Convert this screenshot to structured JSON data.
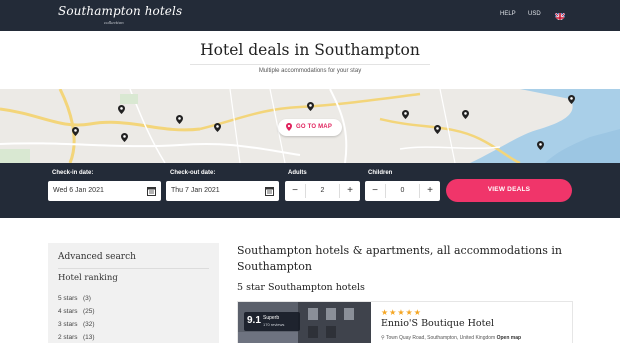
{
  "header": {
    "logo": "Southampton hotels",
    "logo_sub": "collection",
    "help": "HELP",
    "currency": "USD",
    "language_flag": "uk-flag-icon"
  },
  "hero": {
    "title": "Hotel deals in Southampton",
    "subtitle": "Multiple accommodations for your stay"
  },
  "map": {
    "goto_label": "GO TO MAP",
    "water_color": "#a9cfe8",
    "road_color": "#f3d57a"
  },
  "search": {
    "checkin_label": "Check-in date:",
    "checkin_value": "Wed 6 Jan 2021",
    "checkout_label": "Check-out date:",
    "checkout_value": "Thu 7 Jan 2021",
    "adults_label": "Adults",
    "adults_value": "2",
    "children_label": "Children",
    "children_value": "0",
    "minus": "−",
    "plus": "+",
    "view_label": "VIEW DEALS",
    "accent": "#f0356a"
  },
  "sidebar": {
    "title": "Advanced search",
    "ranking_title": "Hotel ranking",
    "ranking": [
      {
        "label": "5 stars",
        "count": "(3)"
      },
      {
        "label": "4 stars",
        "count": "(25)"
      },
      {
        "label": "3 stars",
        "count": "(32)"
      },
      {
        "label": "2 stars",
        "count": "(13)"
      }
    ]
  },
  "main": {
    "title": "Southampton hotels & apartments, all accommodations in Southampton",
    "section_title": "5 star Southampton hotels",
    "card": {
      "score": "9.1",
      "score_word": "Superb",
      "reviews": "170 reviews",
      "stars": "★★★★★",
      "name": "Ennio'S Boutique Hotel",
      "address": "Town Quay Road, Southampton, United Kingdom",
      "open_map": "Open map"
    }
  }
}
